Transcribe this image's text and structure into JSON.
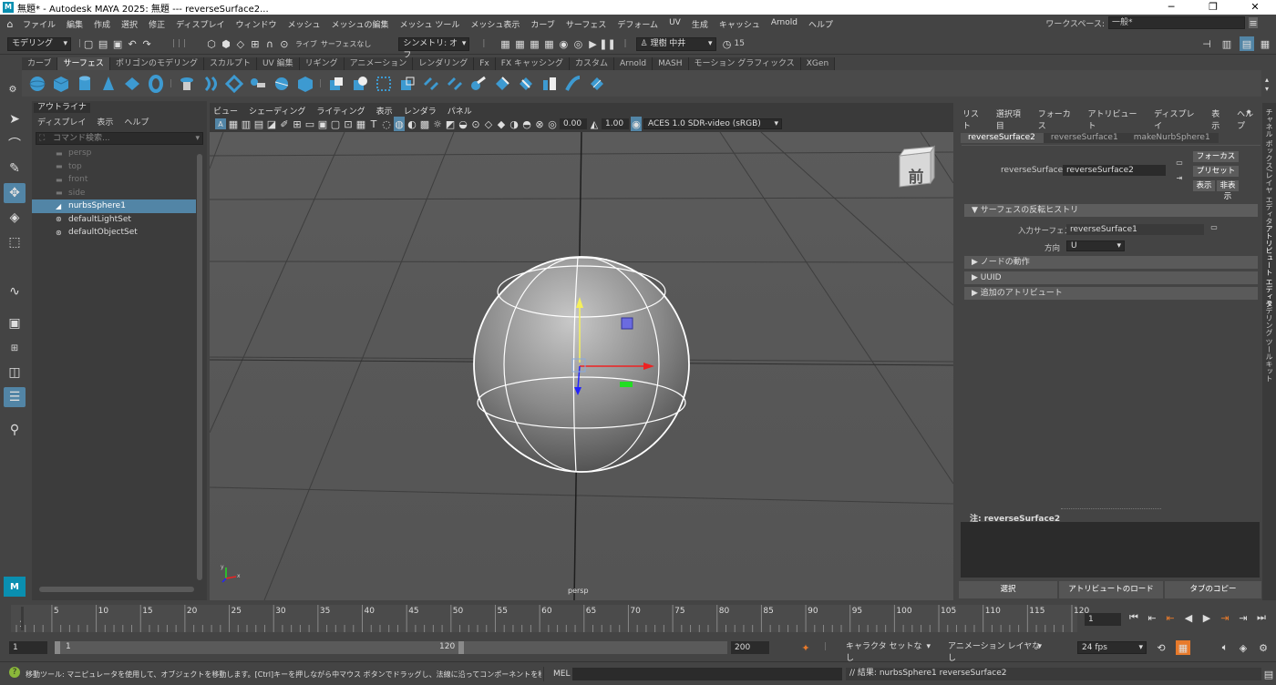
{
  "window": {
    "title": "無題* - Autodesk MAYA 2025: 無題   ---   reverseSurface2...",
    "min": "─",
    "max": "❐",
    "close": "✕"
  },
  "menu": [
    "ファイル",
    "編集",
    "作成",
    "選択",
    "修正",
    "ディスプレイ",
    "ウィンドウ",
    "メッシュ",
    "メッシュの編集",
    "メッシュ ツール",
    "メッシュ表示",
    "カーブ",
    "サーフェス",
    "デフォーム",
    "UV",
    "生成",
    "キャッシュ",
    "Arnold",
    "ヘルプ"
  ],
  "workspace": {
    "label": "ワークスペース:",
    "value": "一般*"
  },
  "status": {
    "mode": "モデリング",
    "live": "ライブ",
    "live_surface": "サーフェスなし",
    "symmetry": "シンメトリ: オフ",
    "user": "理樹 中井",
    "notif": "15"
  },
  "shelf_tabs": [
    "カーブ",
    "サーフェス",
    "ポリゴンのモデリング",
    "スカルプト",
    "UV 編集",
    "リギング",
    "アニメーション",
    "レンダリング",
    "Fx",
    "FX キャッシング",
    "カスタム",
    "Arnold",
    "MASH",
    "モーション グラフィックス",
    "XGen"
  ],
  "shelf_active": "サーフェス",
  "outliner": {
    "tab": "アウトライナ",
    "menu": [
      "ディスプレイ",
      "表示",
      "ヘルプ"
    ],
    "search_placeholder": "コマンド検索...",
    "items": [
      {
        "label": "persp",
        "dim": true,
        "icon": "camera"
      },
      {
        "label": "top",
        "dim": true,
        "icon": "camera"
      },
      {
        "label": "front",
        "dim": true,
        "icon": "camera"
      },
      {
        "label": "side",
        "dim": true,
        "icon": "camera"
      },
      {
        "label": "nurbsSphere1",
        "dim": false,
        "sel": true,
        "icon": "nurbs"
      },
      {
        "label": "defaultLightSet",
        "dim": false,
        "icon": "set"
      },
      {
        "label": "defaultObjectSet",
        "dim": false,
        "icon": "set"
      }
    ]
  },
  "viewport": {
    "menu": [
      "ビュー",
      "シェーディング",
      "ライティング",
      "表示",
      "レンダラ",
      "パネル"
    ],
    "exposure": "0.00",
    "gamma": "1.00",
    "colorspace": "ACES 1.0 SDR-video (sRGB)",
    "camera_label": "persp",
    "viewcube_label": "前",
    "axis_y": "y",
    "axis_x": "x"
  },
  "attr": {
    "menu": [
      "リスト",
      "選択項目",
      "フォーカス",
      "アトリビュート",
      "ディスプレイ",
      "表示",
      "ヘルプ"
    ],
    "tabs": [
      "reverseSurface2",
      "reverseSurface1",
      "makeNurbSphere1"
    ],
    "node_label": "reverseSurface:",
    "node_value": "reverseSurface2",
    "btn_focus": "フォーカス",
    "btn_preset": "プリセット",
    "btn_show": "表示",
    "btn_hide": "非表示",
    "section_history": "サーフェスの反転ヒストリ",
    "input_label": "入力サーフェス",
    "input_value": "reverseSurface1",
    "dir_label": "方向",
    "dir_value": "U",
    "section_node": "ノードの動作",
    "section_uuid": "UUID",
    "section_extra": "追加のアトリビュート",
    "notes_label": "注:  reverseSurface2",
    "btn_select": "選択",
    "btn_load": "アトリビュートのロード",
    "btn_copy": "タブのコピー"
  },
  "side_tabs": [
    "チャネル ボックス/レイヤ エディタ",
    "アトリビュート エディタ",
    "モデリング ツールキット"
  ],
  "timeline": {
    "ticks": [
      "5",
      "10",
      "15",
      "20",
      "25",
      "30",
      "35",
      "40",
      "45",
      "50",
      "55",
      "60",
      "65",
      "70",
      "75",
      "80",
      "85",
      "90",
      "95",
      "100",
      "105",
      "110",
      "115",
      "120"
    ],
    "start_mark": "1",
    "current": "1"
  },
  "range": {
    "start": "1",
    "inner_start": "1",
    "inner_end": "120",
    "end": "200",
    "char_set": "キャラクタ セットなし",
    "anim_layer": "アニメーション レイヤなし",
    "fps": "24 fps"
  },
  "help": "移動ツール: マニピュレータを使用して、オブジェクトを移動します。[Ctrl]キーを押しながら中マウス ボタンでドラッグし、法線に沿ってコンポーネントを移動します。[Shift]キーを押しながらマニピ",
  "cmd": {
    "lang": "MEL",
    "result": "// 結果: nurbsSphere1 reverseSurface2"
  }
}
